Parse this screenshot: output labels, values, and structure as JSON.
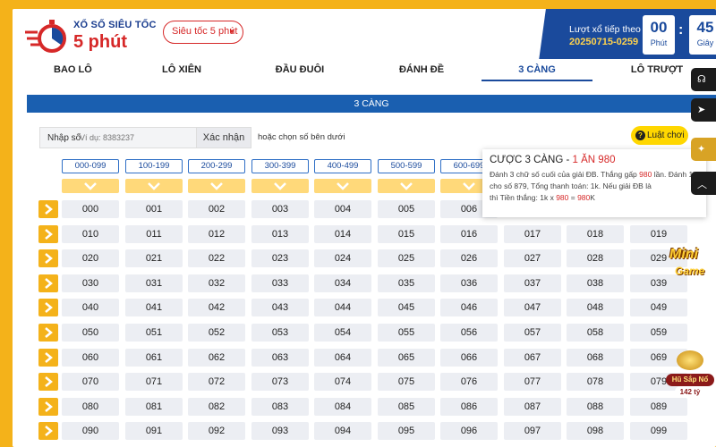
{
  "header": {
    "logo_line1": "XỔ SỐ SIÊU TỐC",
    "logo_line2": "5 phút",
    "mode_select": "Siêu tốc 5 phút",
    "next_draw_label": "Lượt xổ tiếp theo",
    "next_draw_id": "20250715-0259",
    "countdown_minutes": "00",
    "countdown_minutes_unit": "Phút",
    "countdown_seconds": "45",
    "countdown_seconds_unit": "Giây"
  },
  "tabs": [
    "BAO LÔ",
    "LÔ XIÊN",
    "ĐẦU ĐUÔI",
    "ĐÁNH ĐỀ",
    "3 CÀNG",
    "LÔ TRƯỢT"
  ],
  "active_tab": "3 CÀNG",
  "section_title": "3 CÀNG",
  "input": {
    "label": "Nhập số",
    "placeholder": "Ví dụ: 8383237",
    "confirm_label": "Xác nhận",
    "or_text": "hoặc chọn số bên dưới"
  },
  "rules_label": "Luật chơi",
  "ranges": [
    "000-099",
    "100-199",
    "200-299",
    "300-399",
    "400-499",
    "500-599",
    "600-699"
  ],
  "tooltip": {
    "title": "CƯỢC 3 CÀNG - ",
    "title_highlight": "1 ĂN 980",
    "body_1": "Đánh 3 chữ số cuối của giải ĐB. Thắng gấp ",
    "body_2": "980",
    "body_3": " lần. Đánh 1k cho số 879, Tổng thanh toán: 1k. Nếu giải ĐB là ",
    "body_4": " thì Tiền thắng: 1k x ",
    "body_5": "980",
    "body_6": " = ",
    "body_7": "980",
    "body_8": "K"
  },
  "grid_rows": [
    [
      "000",
      "001",
      "002",
      "003",
      "004",
      "005",
      "006",
      "",
      "",
      ""
    ],
    [
      "010",
      "011",
      "012",
      "013",
      "014",
      "015",
      "016",
      "017",
      "018",
      "019"
    ],
    [
      "020",
      "021",
      "022",
      "023",
      "024",
      "025",
      "026",
      "027",
      "028",
      "029"
    ],
    [
      "030",
      "031",
      "032",
      "033",
      "034",
      "035",
      "036",
      "037",
      "038",
      "039"
    ],
    [
      "040",
      "041",
      "042",
      "043",
      "044",
      "045",
      "046",
      "047",
      "048",
      "049"
    ],
    [
      "050",
      "051",
      "052",
      "053",
      "054",
      "055",
      "056",
      "057",
      "058",
      "059"
    ],
    [
      "060",
      "061",
      "062",
      "063",
      "064",
      "065",
      "066",
      "067",
      "068",
      "069"
    ],
    [
      "070",
      "071",
      "072",
      "073",
      "074",
      "075",
      "076",
      "077",
      "078",
      "079"
    ],
    [
      "080",
      "081",
      "082",
      "083",
      "084",
      "085",
      "086",
      "087",
      "088",
      "089"
    ],
    [
      "090",
      "091",
      "092",
      "093",
      "094",
      "095",
      "096",
      "097",
      "098",
      "099"
    ]
  ],
  "promo": {
    "badge1_top": "Mini",
    "badge1_bottom": "Game",
    "badge2_top": "Hũ Sắp Nổ",
    "badge2_bottom": "142 tỷ"
  },
  "colors": {
    "brand_blue": "#1a4a9c",
    "brand_red": "#d62828",
    "accent_yellow": "#f4b21a"
  }
}
